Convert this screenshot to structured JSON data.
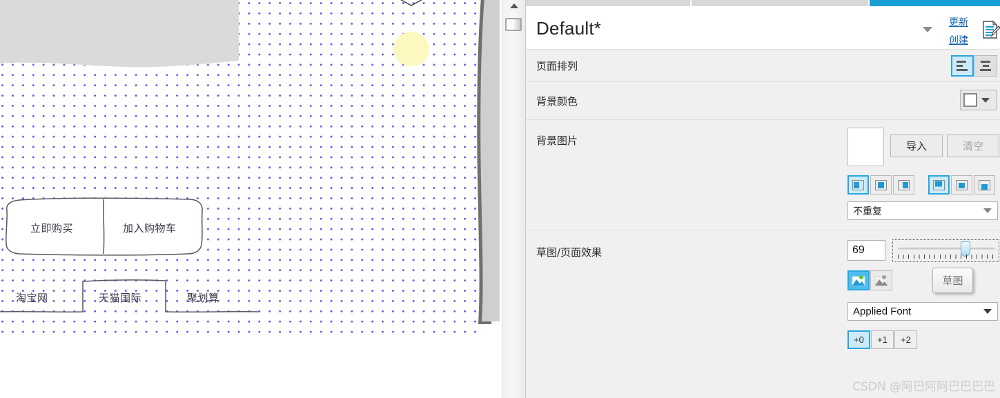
{
  "canvas": {
    "grid_dot_color": "#5b5bf0",
    "shapes": {
      "top_panel_fill": "#dadada",
      "right_panel_fill": "#cfcfcf",
      "highlight_circle_fill": "#fcf8c0"
    },
    "buttons": [
      {
        "label": "立即购买"
      },
      {
        "label": "加入购物车"
      }
    ],
    "tabs": [
      {
        "label": "淘宝网"
      },
      {
        "label": "天猫国际"
      },
      {
        "label": "聚划算"
      }
    ]
  },
  "scrollbar": {
    "up_arrow_icon": "triangle-up-icon",
    "thumb_name": "scroll-thumb"
  },
  "panel": {
    "tabs": [
      {
        "name": "tab-1",
        "active": false
      },
      {
        "name": "tab-2",
        "active": false
      },
      {
        "name": "tab-3",
        "active": true
      }
    ],
    "active_tab_color": "#189fd4",
    "header": {
      "title": "Default*",
      "dropdown_icon": "chevron-down-icon",
      "update_link": "更新",
      "create_link": "创建",
      "edit_icon": "document-edit-icon",
      "link_color": "#1266b5"
    },
    "rows": {
      "page_arrange": {
        "label": "页面排列",
        "options": [
          {
            "name": "align-left",
            "icon": "align-left-icon",
            "selected": true
          },
          {
            "name": "align-center",
            "icon": "align-center-icon",
            "selected": false
          }
        ]
      },
      "bg_color": {
        "label": "背景颜色",
        "swatch_color": "#ffffff",
        "dropdown_icon": "chevron-down-icon"
      },
      "bg_image": {
        "label": "背景图片",
        "thumbnail_color": "#ffffff",
        "import_label": "导入",
        "clear_label": "清空",
        "position_group_1": [
          {
            "name": "bg-pos-left",
            "selected": true
          },
          {
            "name": "bg-pos-center",
            "selected": false
          },
          {
            "name": "bg-pos-right",
            "selected": false
          }
        ],
        "position_group_2": [
          {
            "name": "bg-pos-top",
            "selected": true
          },
          {
            "name": "bg-pos-middle",
            "selected": false
          },
          {
            "name": "bg-pos-bottom",
            "selected": false
          }
        ],
        "repeat_value": "不重复"
      },
      "sketch": {
        "label": "草图/页面效果",
        "value": "69",
        "slider_min": 0,
        "slider_max": 100,
        "slider_value": 69,
        "image_modes": [
          {
            "name": "image-color-icon",
            "selected": true
          },
          {
            "name": "image-gray-icon",
            "selected": false
          }
        ],
        "sketch_button_label": "草图",
        "font_value": "Applied Font",
        "font_dropdown_icon": "chevron-down-icon",
        "offset_options": [
          {
            "label": "+0",
            "selected": true
          },
          {
            "label": "+1",
            "selected": false
          },
          {
            "label": "+2",
            "selected": false
          }
        ]
      }
    }
  },
  "watermark": {
    "text": "CSDN @阿巴阿阿巴巴巴巴"
  }
}
